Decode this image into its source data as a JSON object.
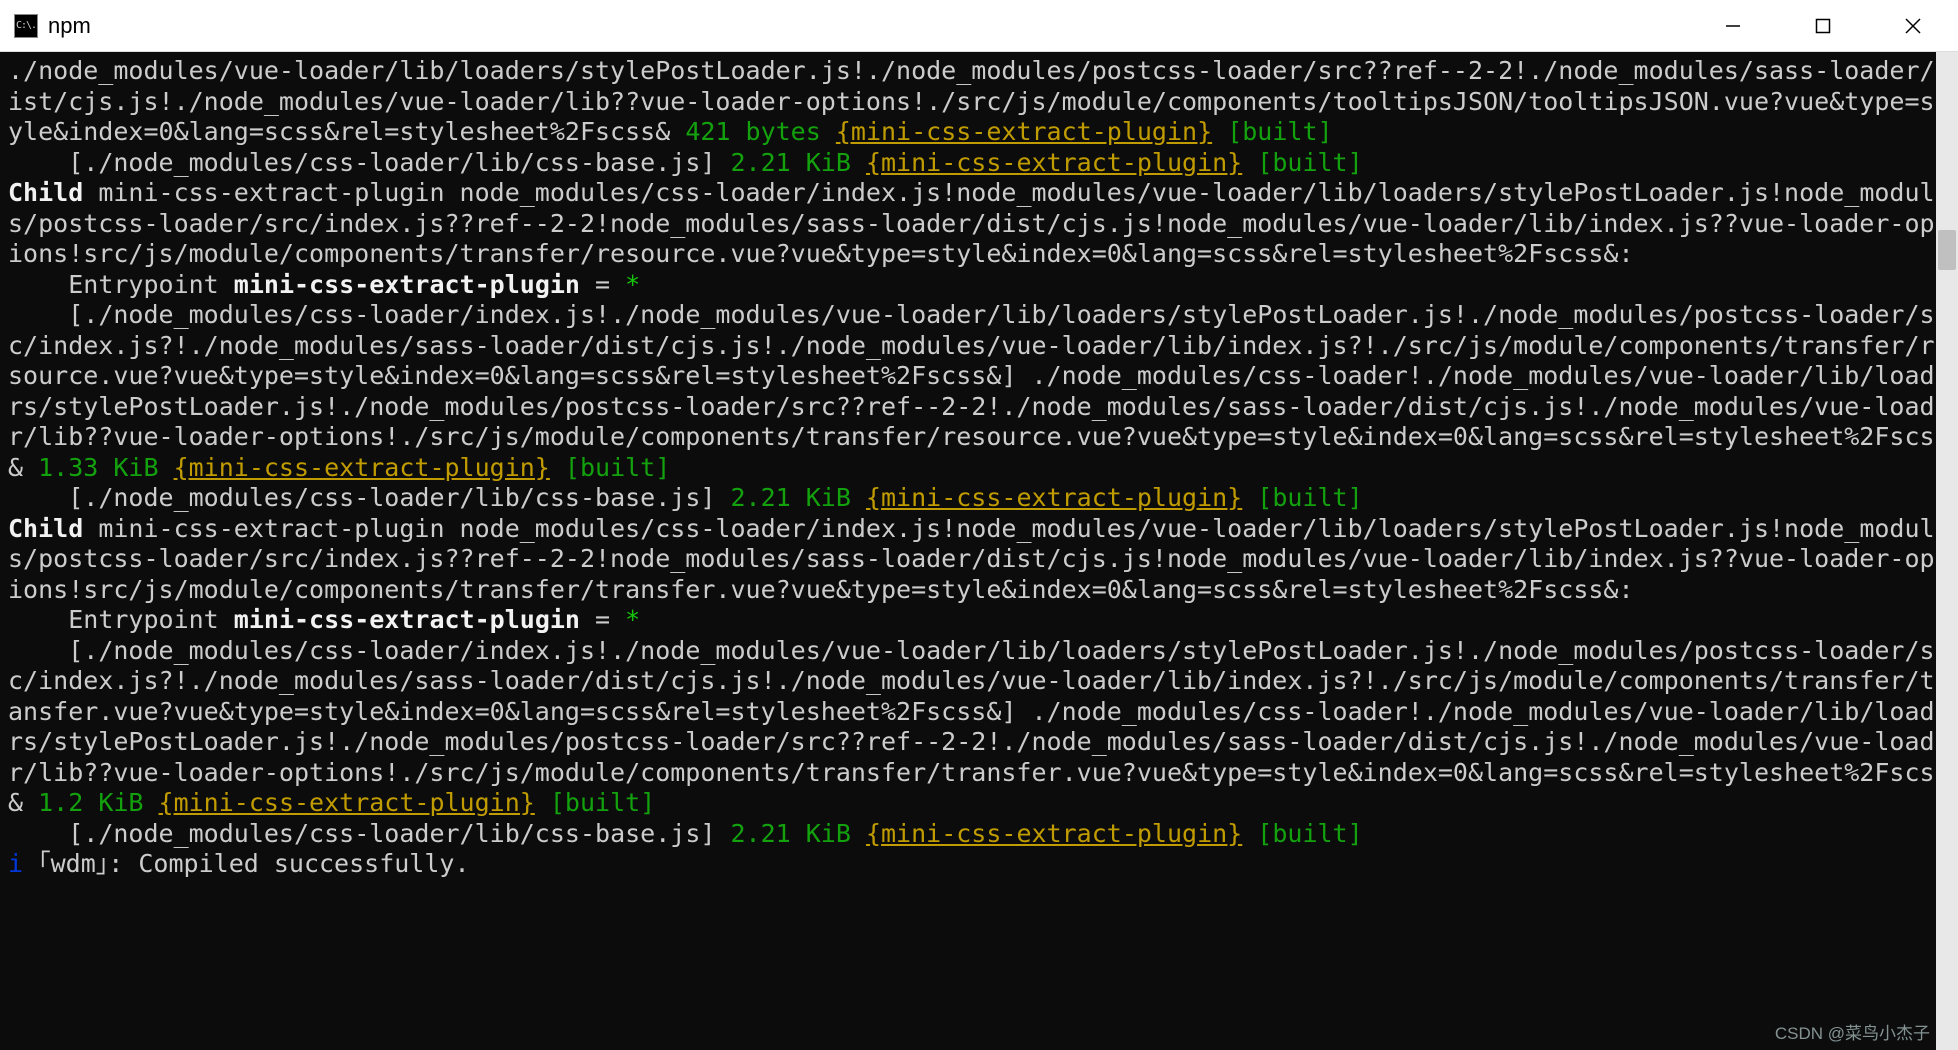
{
  "window": {
    "title": "npm",
    "icon_text": "C:\\."
  },
  "watermark": "CSDN @菜鸟小杰子",
  "term": {
    "l1_a": "./node_modules/vue-loader/lib/loaders/stylePostLoader.js!./node_modules/postcss-loader/src??ref--2-2!./node_modules/sass-loader/dist/cjs.js!./node_modules/vue-loader/lib??vue-loader-options!./src/js/module/components/tooltipsJSON/tooltipsJSON.vue?vue&type=style&index=0&lang=scss&rel=stylesheet%2Fscss&",
    "l1_size": " 421 bytes ",
    "l1_chunk": "{mini-css-extract-plugin}",
    "built": " [built]",
    "l2_a": "    [./node_modules/css-loader/lib/css-base.js] ",
    "l2_size": "2.21 KiB ",
    "child_label": "Child",
    "child1_rest": " mini-css-extract-plugin node_modules/css-loader/index.js!node_modules/vue-loader/lib/loaders/stylePostLoader.js!node_modules/postcss-loader/src/index.js??ref--2-2!node_modules/sass-loader/dist/cjs.js!node_modules/vue-loader/lib/index.js??vue-loader-options!src/js/module/components/transfer/resource.vue?vue&type=style&index=0&lang=scss&rel=stylesheet%2Fscss&:",
    "entry_a": "    Entrypoint ",
    "entry_b": "mini-css-extract-plugin",
    "entry_c": " = ",
    "entry_star": "*",
    "b1_bracket": "    [./node_modules/css-loader/index.js!./node_modules/vue-loader/lib/loaders/stylePostLoader.js!./node_modules/postcss-loader/src/index.js?!./node_modules/sass-loader/dist/cjs.js!./node_modules/vue-loader/lib/index.js?!./src/js/module/components/transfer/resource.vue?vue&type=style&index=0&lang=scss&rel=stylesheet%2Fscss&] ",
    "b1_tail": "./node_modules/css-loader!./node_modules/vue-loader/lib/loaders/stylePostLoader.js!./node_modules/postcss-loader/src??ref--2-2!./node_modules/sass-loader/dist/cjs.js!./node_modules/vue-loader/lib??vue-loader-options!./src/js/module/components/transfer/resource.vue?vue&type=style&index=0&lang=scss&rel=stylesheet%2Fscss&",
    "b1_size": " 1.33 KiB ",
    "child2_rest": " mini-css-extract-plugin node_modules/css-loader/index.js!node_modules/vue-loader/lib/loaders/stylePostLoader.js!node_modules/postcss-loader/src/index.js??ref--2-2!node_modules/sass-loader/dist/cjs.js!node_modules/vue-loader/lib/index.js??vue-loader-options!src/js/module/components/transfer/transfer.vue?vue&type=style&index=0&lang=scss&rel=stylesheet%2Fscss&:",
    "b2_bracket": "    [./node_modules/css-loader/index.js!./node_modules/vue-loader/lib/loaders/stylePostLoader.js!./node_modules/postcss-loader/src/index.js?!./node_modules/sass-loader/dist/cjs.js!./node_modules/vue-loader/lib/index.js?!./src/js/module/components/transfer/transfer.vue?vue&type=style&index=0&lang=scss&rel=stylesheet%2Fscss&] ",
    "b2_tail": "./node_modules/css-loader!./node_modules/vue-loader/lib/loaders/stylePostLoader.js!./node_modules/postcss-loader/src??ref--2-2!./node_modules/sass-loader/dist/cjs.js!./node_modules/vue-loader/lib??vue-loader-options!./src/js/module/components/transfer/transfer.vue?vue&type=style&index=0&lang=scss&rel=stylesheet%2Fscss&",
    "b2_size": " 1.2 KiB ",
    "final_i": "i",
    "final_wdm": " ｢wdm｣",
    "final_msg": ": Compiled successfully."
  }
}
